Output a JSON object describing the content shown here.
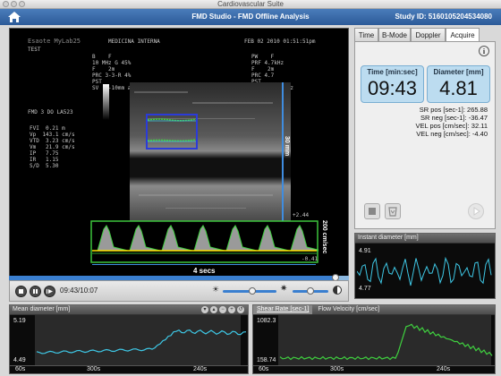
{
  "window": {
    "title": "Cardiovascular Suite"
  },
  "app": {
    "title": "FMD Studio - FMD Offline Analysis",
    "study_id": "Study ID: 5160105204534080"
  },
  "tabs": [
    "Time",
    "B-Mode",
    "Doppler",
    "Acquire"
  ],
  "ultrasound": {
    "brand": "Esaote MyLab25",
    "dept": "MEDICINA INTERNA",
    "datetime": "FEB 02 2010 01:51:51pm",
    "patient": "TEST",
    "left_params": "B    F\n10 MHz G 45%\nF    2m\nPRC 3-3-R 4%\nPST\nSV  2-10mm a +70°",
    "right_params": "PW    F\nPRF 4.7kHz\nF    2m\nPRC 4.7\nPST\nFF     100 Hz",
    "mode": "FMD 3 DO LA523",
    "measurements": "FVI  0.21 m\nVp  143.1 cm/s\nVTD  3.23 cm/s\nVm   21.9 cm/s\nIP   7.75\nIR   1.15\nS/D  5.30",
    "depth_label": "30 mm",
    "velocity_label": "200 cm/sec",
    "time_label": "4 secs",
    "scale_top": "+2.44",
    "scale_bottom": "-0.41"
  },
  "transport": {
    "time": "09:43/10:07",
    "progress": 0.96,
    "brightness": 0.55,
    "contrast": 0.5
  },
  "acquire": {
    "time_label": "Time [min:sec]",
    "time_value": "09:43",
    "diameter_label": "Diameter [mm]",
    "diameter_value": "4.81",
    "stats": [
      "SR pos [sec-1]: 265.88",
      "SR neg [sec-1]: -36.47",
      "VEL pos [cm/sec]: 32.11",
      "VEL neg [cm/sec]: -4.40"
    ]
  },
  "instant_diameter": {
    "title": "Instant diameter [mm]",
    "ymax": "4.91",
    "ymin": "4.77"
  },
  "mean_diameter": {
    "title": "Mean diameter [mm]",
    "ymax": "5.19",
    "ymin": "4.49",
    "ticks": [
      "60s",
      "300s",
      "240s"
    ]
  },
  "shear": {
    "tab_shear": "Shear Rate [sec-1]",
    "tab_flow": "Flow Velocity [cm/sec]",
    "ymax": "1082.3",
    "ymin": "158.74",
    "ticks": [
      "60s",
      "300s",
      "240s"
    ]
  },
  "colors": {
    "accent": "#2c5a98",
    "trace_cyan": "#3ec8e6",
    "trace_green": "#3fd13f",
    "roi_blue": "#2b3bd9",
    "doppler_box": "#3cc43c"
  }
}
